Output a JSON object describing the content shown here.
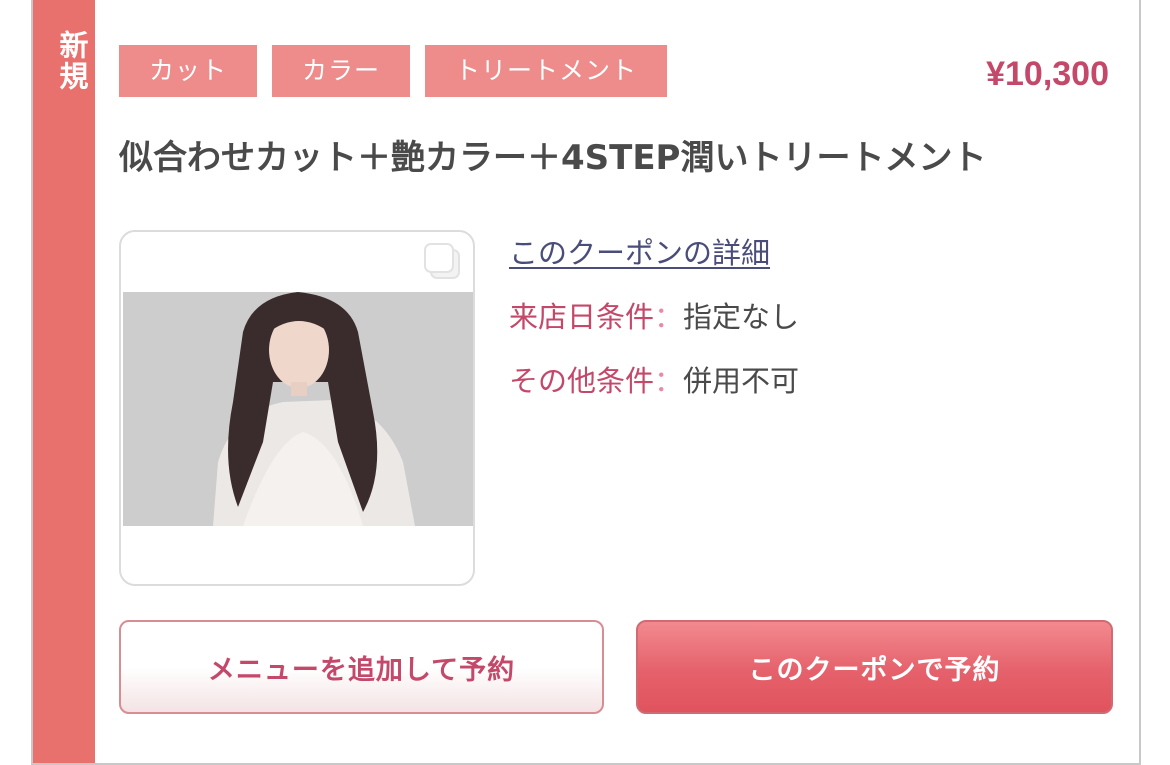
{
  "badge": {
    "text": "新規"
  },
  "tags": [
    "カット",
    "カラー",
    "トリートメント"
  ],
  "price": "¥10,300",
  "title": "似合わせカット＋艶カラー＋4STEP潤いトリートメント",
  "detail_link": "このクーポンの詳細",
  "conditions": [
    {
      "label": "来店日条件",
      "sep": "：",
      "value": "指定なし"
    },
    {
      "label": "その他条件",
      "sep": "：",
      "value": "併用不可"
    }
  ],
  "buttons": {
    "add_menu": "メニューを追加して予約",
    "reserve": "このクーポンで予約"
  },
  "colors": {
    "accent": "#e8716d",
    "tag_bg": "#ee8c8c",
    "price": "#c4486a",
    "link": "#4a4d7a"
  }
}
